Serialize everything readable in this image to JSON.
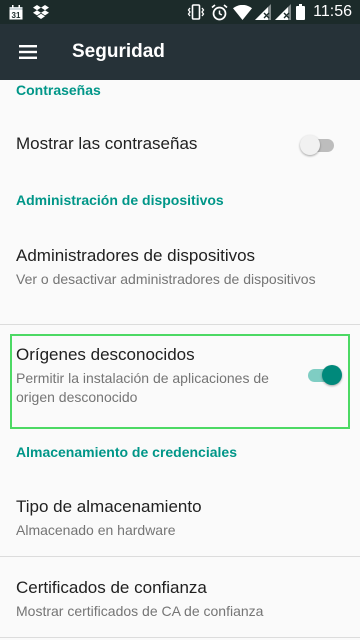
{
  "status_bar": {
    "time": "11:56",
    "icons": [
      "calendar-icon",
      "dropbox-icon",
      "vibrate-icon",
      "alarm-icon",
      "wifi-icon",
      "signal-icon",
      "signal-icon",
      "battery-icon"
    ],
    "calendar_day": "31"
  },
  "app_bar": {
    "menu_icon": "menu-icon",
    "title": "Seguridad"
  },
  "sections": {
    "passwords": {
      "header": "Contraseñas",
      "show_passwords": {
        "title": "Mostrar las contraseñas",
        "enabled": false
      }
    },
    "device_admin": {
      "header": "Administración de dispositivos",
      "admins": {
        "title": "Administradores de dispositivos",
        "summary": "Ver o desactivar administradores de dispositivos"
      },
      "unknown_sources": {
        "title": "Orígenes desconocidos",
        "summary": "Permitir la instalación de aplicaciones de origen desconocido",
        "enabled": true
      }
    },
    "credentials": {
      "header": "Almacenamiento de credenciales",
      "storage_type": {
        "title": "Tipo de almacenamiento",
        "summary": "Almacenado en hardware"
      },
      "trusted_certs": {
        "title": "Certificados de confianza",
        "summary": "Mostrar certificados de CA de confianza"
      }
    }
  },
  "colors": {
    "accent": "#009688",
    "toolbar": "#263238",
    "status_bar": "#1c2b2a",
    "highlight": "#4cd964"
  }
}
